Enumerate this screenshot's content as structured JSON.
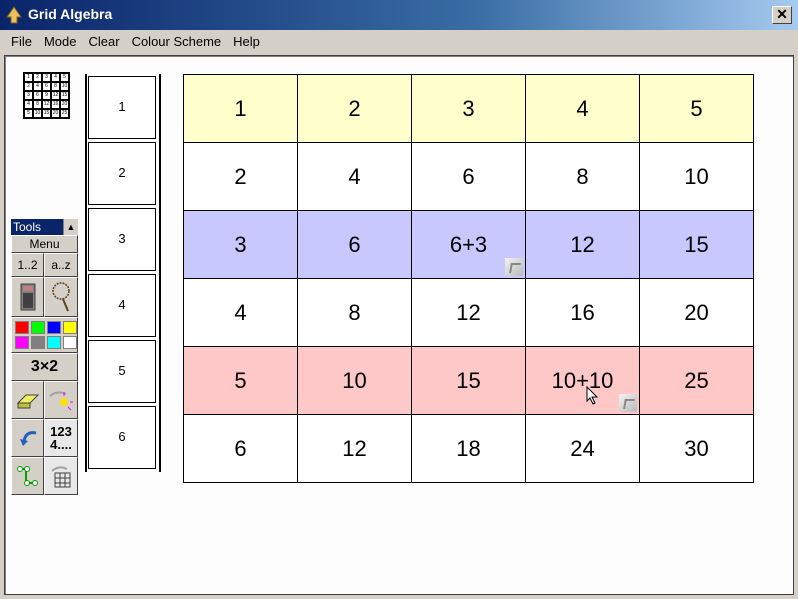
{
  "window": {
    "title": "Grid Algebra",
    "close_label": "✕"
  },
  "menu": [
    "File",
    "Mode",
    "Clear",
    "Colour Scheme",
    "Help"
  ],
  "thumbnail": [
    [
      "1",
      "2",
      "3",
      "4",
      "5"
    ],
    [
      "2",
      "4",
      "6",
      "8",
      "10"
    ],
    [
      "3",
      "6",
      "9",
      "12",
      "15"
    ],
    [
      "4",
      "8",
      "12",
      "16",
      "20"
    ],
    [
      "5",
      "10",
      "15",
      "20",
      "25"
    ]
  ],
  "row_labels": [
    "1",
    "2",
    "3",
    "4",
    "5",
    "6"
  ],
  "tools": {
    "header": "Tools",
    "menu_label": "Menu",
    "numbers_label": "1..2",
    "letters_label": "a..z",
    "dims_label": "3×2",
    "sequence_label_1": "123",
    "sequence_label_2": "4....",
    "palette": [
      "#ff0000",
      "#00ff00",
      "#0000ff",
      "#ffff00",
      "#ff00ff",
      "#808080",
      "#00ffff",
      "#ffffff"
    ]
  },
  "grid": {
    "rows": [
      {
        "color": "#ffffcc",
        "cells": [
          "1",
          "2",
          "3",
          "4",
          "5"
        ]
      },
      {
        "color": "#ffffff",
        "cells": [
          "2",
          "4",
          "6",
          "8",
          "10"
        ]
      },
      {
        "color": "#c8c8ff",
        "cells": [
          "3",
          "6",
          "6+3",
          "12",
          "15"
        ]
      },
      {
        "color": "#ffffff",
        "cells": [
          "4",
          "8",
          "12",
          "16",
          "20"
        ]
      },
      {
        "color": "#ffc8c8",
        "cells": [
          "5",
          "10",
          "15",
          "10+10",
          "25"
        ]
      },
      {
        "color": "#ffffff",
        "cells": [
          "6",
          "12",
          "18",
          "24",
          "30"
        ]
      }
    ],
    "expression_cells": [
      [
        2,
        2
      ],
      [
        4,
        3
      ]
    ]
  }
}
